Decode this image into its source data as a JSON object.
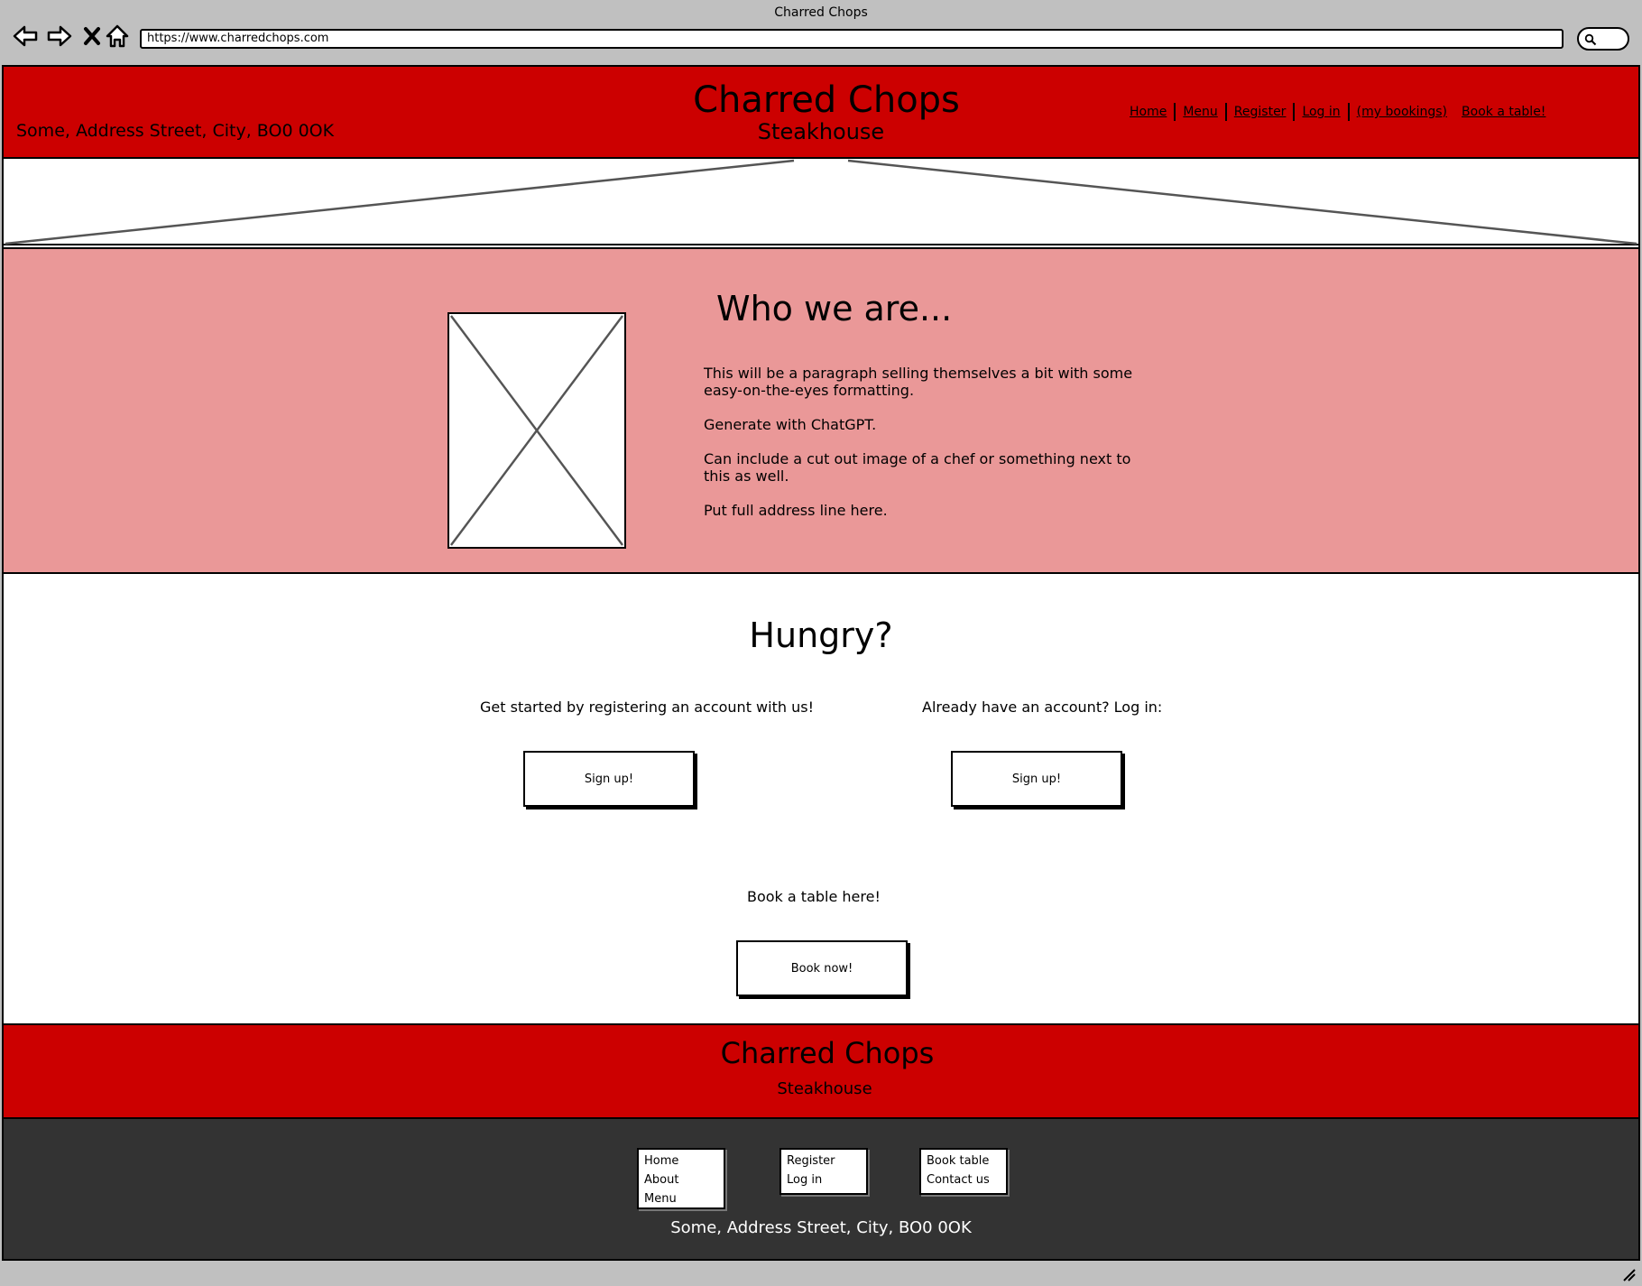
{
  "browser": {
    "window_title": "Charred Chops",
    "url": "https://www.charredchops.com"
  },
  "header": {
    "address": "Some, Address Street, City, BO0 0OK",
    "title": "Charred Chops",
    "subtitle": "Steakhouse",
    "nav": [
      "Home",
      "Menu",
      "Register",
      "Log in",
      "(my bookings)",
      "Book a table!"
    ]
  },
  "about": {
    "title": "Who we are...",
    "paragraphs": [
      "This will be a paragraph selling themselves a bit with some easy-on-the-eyes formatting.",
      "Generate with ChatGPT.",
      "Can include a cut out image of a chef or something next to this as well.",
      "Put full address line here."
    ]
  },
  "hungry": {
    "title": "Hungry?",
    "register_text": "Get started by registering an account with us!",
    "register_button": "Sign up!",
    "login_text": "Already have an account? Log in:",
    "login_button": "Sign up!",
    "book_text": "Book a table here!",
    "book_button": "Book now!"
  },
  "footer": {
    "title": "Charred Chops",
    "subtitle": "Steakhouse",
    "col1": [
      "Home",
      "About",
      "Menu"
    ],
    "col2": [
      "Register",
      "Log in"
    ],
    "col3": [
      "Book table",
      "Contact us"
    ],
    "address": "Some, Address Street, City, BO0 0OK"
  },
  "colors": {
    "brand_red": "#cc0000",
    "about_pink": "#ea9898",
    "footer_dark": "#333333"
  }
}
